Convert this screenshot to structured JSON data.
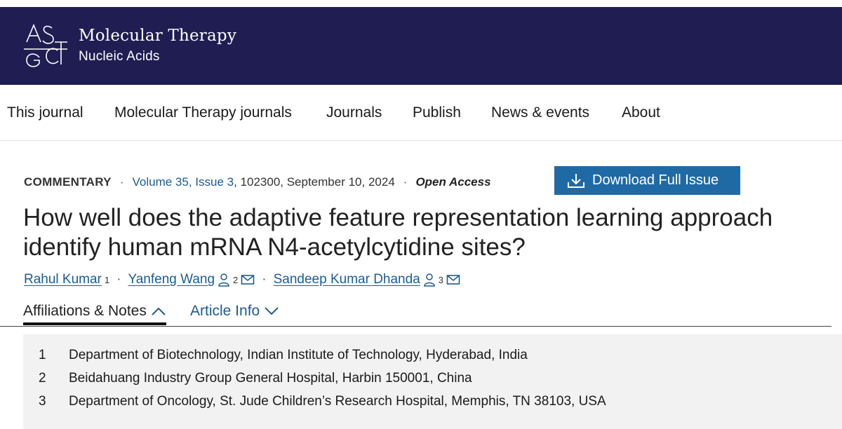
{
  "header": {
    "logo_text": "ASGCT",
    "journal_title": "Molecular Therapy",
    "journal_subtitle": "Nucleic Acids",
    "background_color": "#1f1d52"
  },
  "nav": {
    "items": [
      {
        "label": "This journal"
      },
      {
        "label": "Molecular Therapy journals"
      },
      {
        "label": "Journals"
      },
      {
        "label": "Publish"
      },
      {
        "label": "News & events"
      },
      {
        "label": "About"
      }
    ]
  },
  "article": {
    "type": "COMMENTARY",
    "volume_issue": "Volume 35, Issue 3",
    "citation_rest": ", 102300, September 10, 2024",
    "access": "Open Access",
    "download_label": "Download Full Issue",
    "title": "How well does the adaptive feature representation learning approach identify human mRNA N4-acetylcytidine sites?"
  },
  "authors": [
    {
      "name": "Rahul Kumar",
      "affil": "1"
    },
    {
      "name": "Yanfeng Wang",
      "affil": "2"
    },
    {
      "name": "Sandeep Kumar Dhanda",
      "affil": "3"
    }
  ],
  "tabs": {
    "affiliations_label": "Affiliations & Notes",
    "article_info_label": "Article Info"
  },
  "affiliations": [
    {
      "num": "1",
      "text": "Department of Biotechnology, Indian Institute of Technology, Hyderabad, India"
    },
    {
      "num": "2",
      "text": "Beidahuang Industry Group General Hospital, Harbin 150001, China"
    },
    {
      "num": "3",
      "text": "Department of Oncology, St. Jude Children’s Research Hospital, Memphis, TN 38103, USA"
    }
  ],
  "colors": {
    "link": "#1d5b91",
    "button": "#1f6aa5"
  }
}
